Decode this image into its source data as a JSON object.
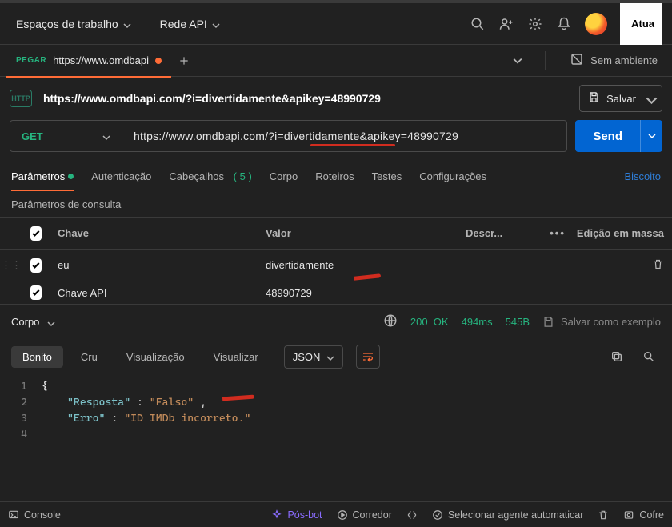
{
  "topbar": {
    "workspaces": "Espaços de trabalho",
    "apinet": "Rede API",
    "upgrade": "Atua"
  },
  "tab": {
    "method": "PEGAR",
    "title": "https://www.omdbapi"
  },
  "env": {
    "none": "Sem ambiente"
  },
  "breadcrumb": "https://www.omdbapi.com/?i=divertidamente&apikey=48990729",
  "save": "Salvar",
  "method": "GET",
  "url": "https://www.omdbapi.com/?i=divertidamente&apikey=48990729",
  "send": "Send",
  "reqtabs": {
    "params": "Parâmetros",
    "auth": "Autenticação",
    "headers": "Cabeçalhos",
    "headers_count": "( 5 )",
    "body": "Corpo",
    "scripts": "Roteiros",
    "tests": "Testes",
    "settings": "Configurações",
    "cookies": "Biscoito"
  },
  "params_title": "Parâmetros de consulta",
  "cols": {
    "key": "Chave",
    "value": "Valor",
    "desc": "Descr...",
    "bulk": "Edição em massa"
  },
  "rows": [
    {
      "key": "eu",
      "value": "divertidamente"
    },
    {
      "key": "Chave API",
      "value": "48990729"
    }
  ],
  "resp": {
    "body": "Corpo",
    "status_code": "200",
    "status_text": "OK",
    "time": "494ms",
    "size": "545B",
    "save_example": "Salvar como exemplo"
  },
  "resptabs": {
    "pretty": "Bonito",
    "raw": "Cru",
    "preview": "Visualização",
    "visualize": "Visualizar",
    "json": "JSON"
  },
  "json": {
    "k1": "\"Resposta\"",
    "v1": "\"Falso\"",
    "k2": "\"Erro\"",
    "v2": "\"ID IMDb incorreto.\""
  },
  "footer": {
    "console": "Console",
    "postbot": "Pós-bot",
    "runner": "Corredor",
    "agent": "Selecionar agente automaticar",
    "vault": "Cofre"
  }
}
